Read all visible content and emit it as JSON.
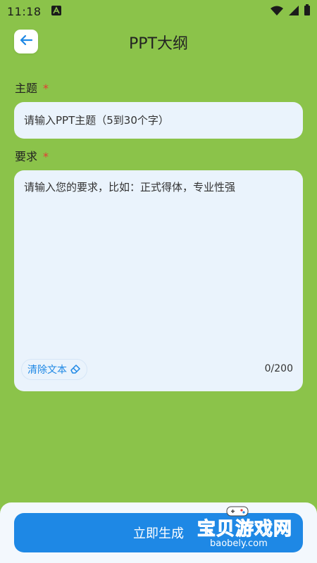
{
  "status_bar": {
    "time": "11:18"
  },
  "header": {
    "title": "PPT大纲"
  },
  "form": {
    "topic": {
      "label": "主题",
      "required_mark": "*",
      "placeholder": "请输入PPT主题（5到30个字）",
      "value": ""
    },
    "requirements": {
      "label": "要求",
      "required_mark": "*",
      "placeholder": "请输入您的要求，比如：正式得体，专业性强",
      "value": "",
      "clear_label": "清除文本",
      "counter": "0/200"
    }
  },
  "actions": {
    "generate_label": "立即生成"
  },
  "watermark": {
    "text": "宝贝游戏网",
    "url": "baobely.com"
  },
  "colors": {
    "background": "#8BC34A",
    "field": "#EAF3FC",
    "accent": "#1E88E5",
    "required": "#e53935"
  },
  "icons": [
    "android-notification-icon",
    "wifi-icon",
    "signal-icon",
    "battery-icon",
    "back-arrow-icon",
    "eraser-icon",
    "gamepad-icon"
  ]
}
